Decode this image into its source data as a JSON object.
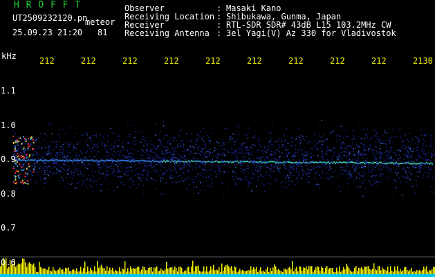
{
  "header": {
    "logo_text": "H R O F F T",
    "file_name": "UT2509232120.pn",
    "mode": "meteor",
    "datetime": "25.09.23 21:20",
    "count": "81",
    "fields": [
      {
        "label": "Observer",
        "value": "Masaki Kano"
      },
      {
        "label": "Receiving Location",
        "value": "Shibukawa, Gunma, Japan"
      },
      {
        "label": "Receiver",
        "value": "RTL-SDR SDR# 43dB L15 103.2MHz CW"
      },
      {
        "label": "Receiving Antenna",
        "value": "3el Yagi(V) Az 330 for Vladivostok"
      }
    ],
    "separator": ":"
  },
  "axis": {
    "unit": "kHz",
    "y_ticks": [
      "1.1",
      "1.0",
      "0.9",
      "0.8",
      "0.7",
      "0.6"
    ],
    "x_ticks": [
      "212",
      "212",
      "212",
      "212",
      "212",
      "212",
      "212",
      "212",
      "212",
      "2130"
    ]
  },
  "colors": {
    "text": "#ffffff",
    "logo": "#22d23a",
    "x_ticks": "#f2f000",
    "noise": "#1e2fa8",
    "signal": "#36c0a0",
    "meteor": "#ff3030",
    "bars": "#f2f000",
    "baseline": "#00c8e8"
  }
}
